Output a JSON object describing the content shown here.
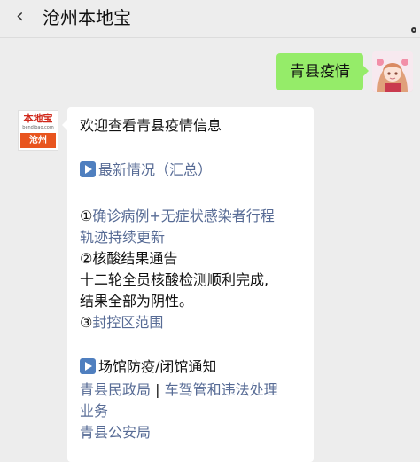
{
  "header": {
    "back_glyph": "‹",
    "title": "沧州本地宝"
  },
  "outgoing": {
    "text": "青县疫情"
  },
  "bot": {
    "brand": "本地宝",
    "domain": "bendibao.com",
    "city": "沧州"
  },
  "message": {
    "intro": "欢迎查看青县疫情信息",
    "latest_link": "最新情况（汇总）",
    "item1_num": "①",
    "item1_line1": "确诊病例+无症状感染者行程",
    "item1_line2": "轨迹持续更新",
    "item2": "②核酸结果通告",
    "item2_body1": "十二轮全员核酸检测顺利完成,",
    "item2_body2": "结果全部为阴性。",
    "item3_num": "③",
    "item3_link": "封控区范围",
    "venue_heading": "场馆防疫/闭馆通知",
    "link_civil": "青县民政局",
    "separator": " | ",
    "link_vehicle1": "车驾管和违法处理",
    "link_vehicle2": "业务",
    "link_police": "青县公安局"
  },
  "icons": {
    "back": "back-chevron-icon",
    "more": "more-icon",
    "play": "play-icon"
  },
  "colors": {
    "background": "#ededed",
    "outgoing_bubble": "#95ec69",
    "link": "#576b95",
    "brand_orange": "#e8541e"
  }
}
